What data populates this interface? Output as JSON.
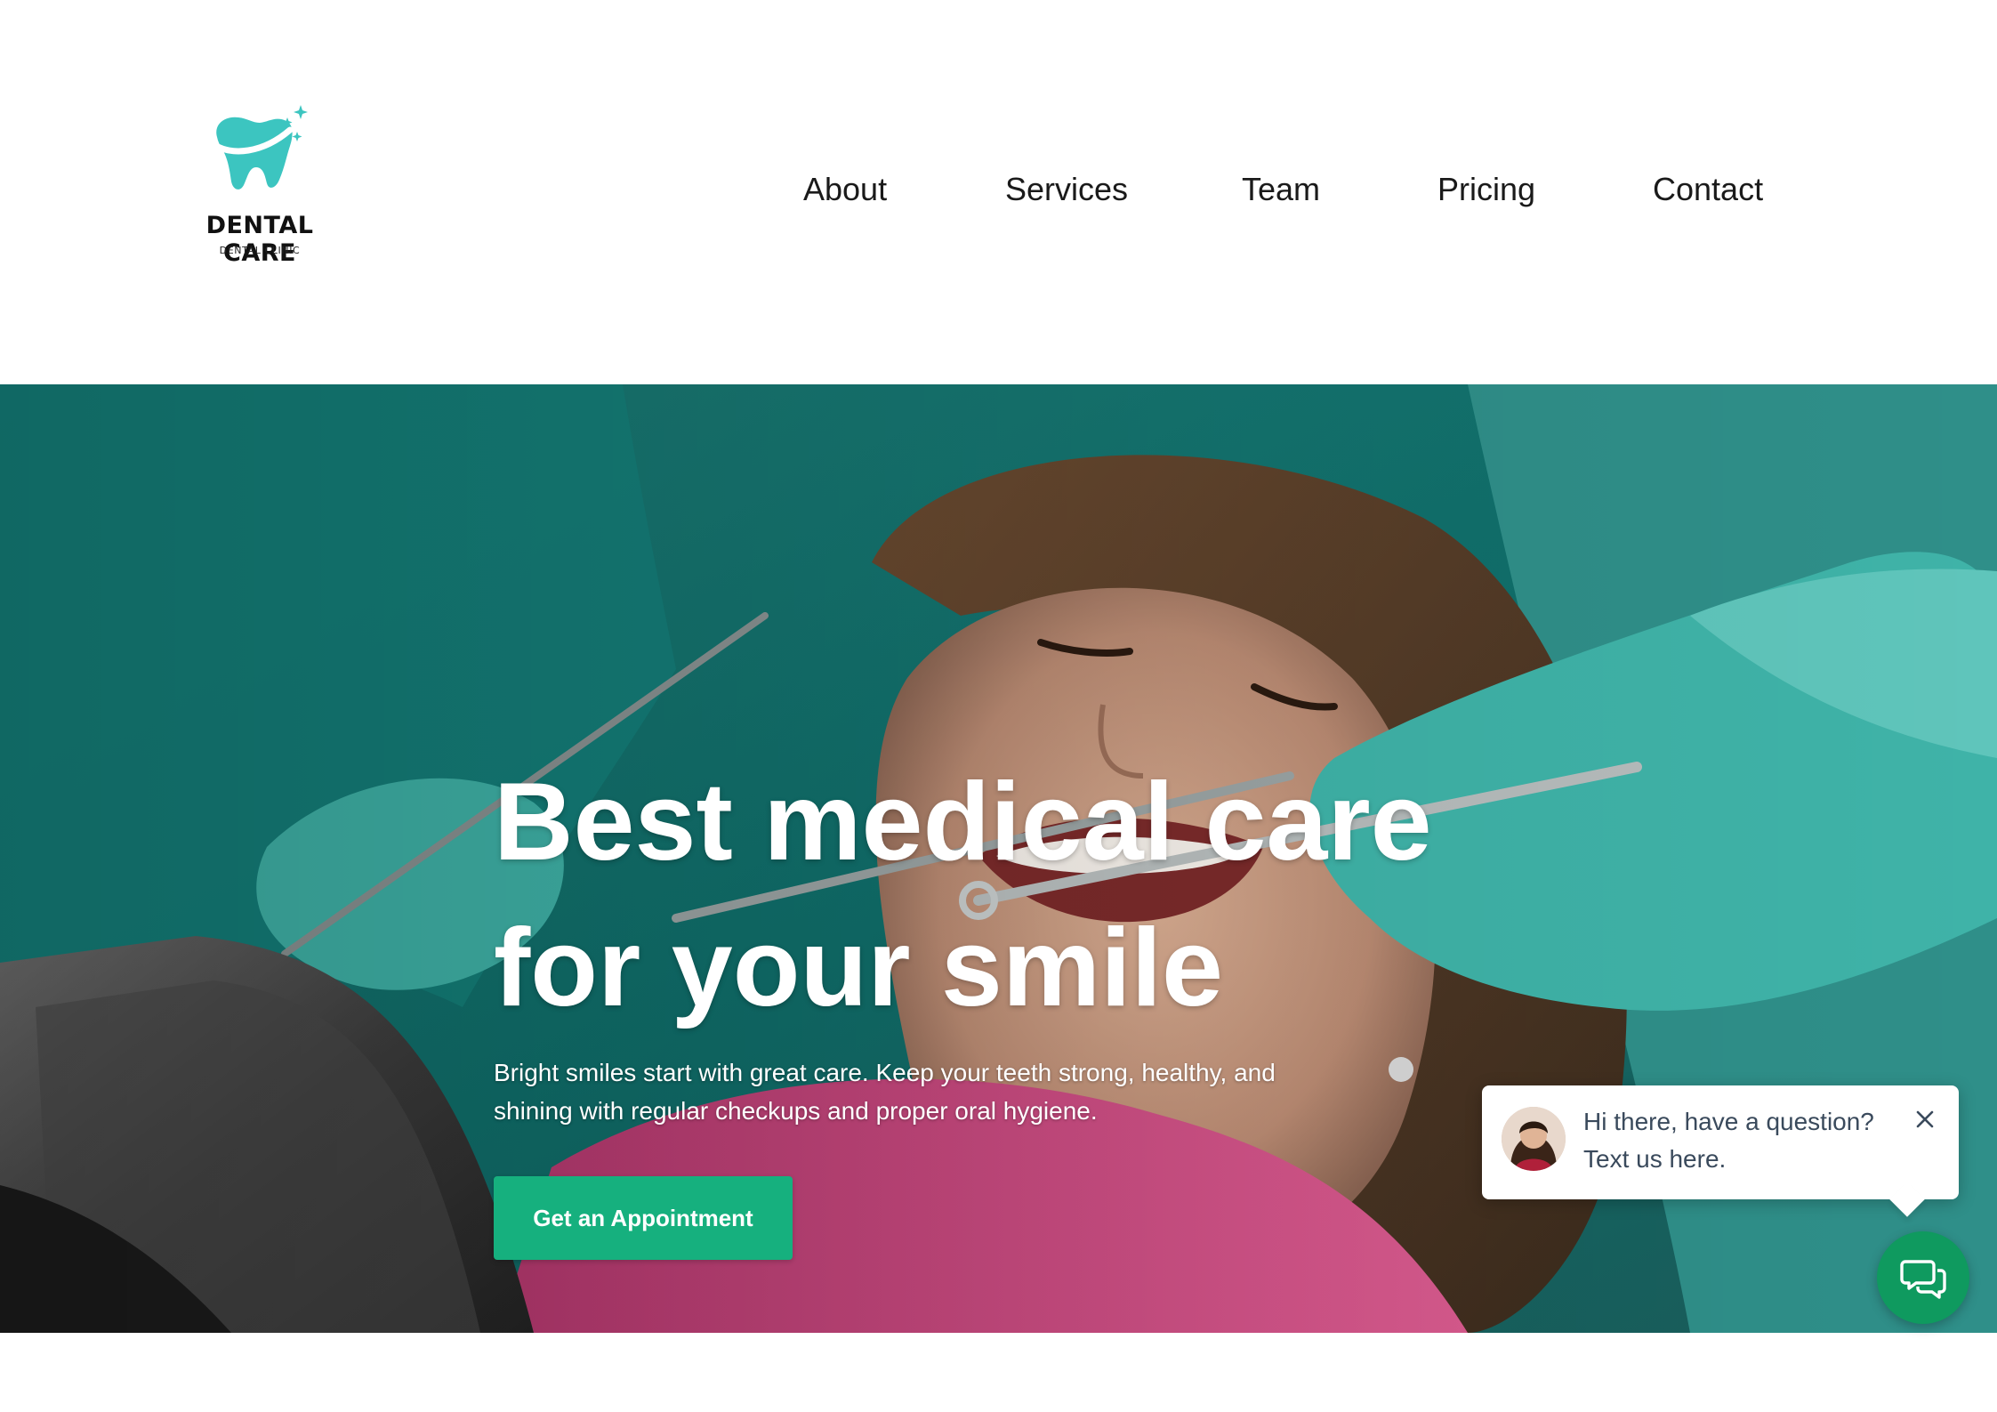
{
  "brand": {
    "name": "DENTAL CARE",
    "tagline": "DENTAL CLINIC",
    "accent_color": "#3cc5c0"
  },
  "nav": {
    "items": [
      {
        "label": "About"
      },
      {
        "label": "Services"
      },
      {
        "label": "Team"
      },
      {
        "label": "Pricing"
      },
      {
        "label": "Contact"
      }
    ]
  },
  "hero": {
    "title_line1": "Best medical care",
    "title_line2": "for your smile",
    "subtitle_line1": "Bright smiles start with great care. Keep your teeth strong, healthy, and",
    "subtitle_line2": "shining with regular checkups and proper oral hygiene.",
    "cta_label": "Get an Appointment",
    "cta_color": "#16b07e"
  },
  "chat": {
    "message_line1": "Hi there, have a question?",
    "message_line2": "Text us here.",
    "fab_color": "#0f9a5f",
    "icons": {
      "close": "close-icon",
      "chat": "chat-bubbles-icon"
    }
  }
}
